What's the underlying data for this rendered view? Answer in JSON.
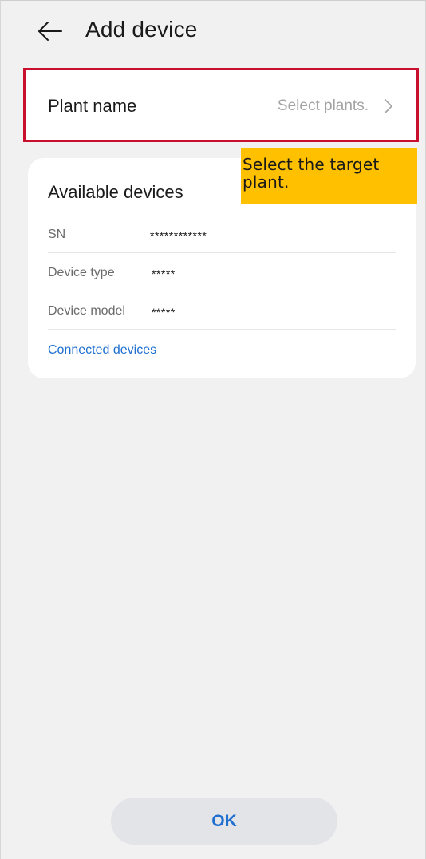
{
  "header": {
    "title": "Add device",
    "back_icon": "arrow-left-icon"
  },
  "plant": {
    "label": "Plant name",
    "value": "Select plants.",
    "chevron_icon": "chevron-right-icon",
    "highlight_color": "#c8102e"
  },
  "tooltip": {
    "text": "Select the target plant.",
    "background": "#ffc000"
  },
  "devices": {
    "heading": "Available devices",
    "rows": [
      {
        "label": "SN",
        "value": "************"
      },
      {
        "label": "Device type",
        "value": "*****"
      },
      {
        "label": "Device model",
        "value": "*****"
      }
    ],
    "link_label": "Connected devices",
    "link_color": "#1e6fd0"
  },
  "footer": {
    "ok_label": "OK"
  }
}
